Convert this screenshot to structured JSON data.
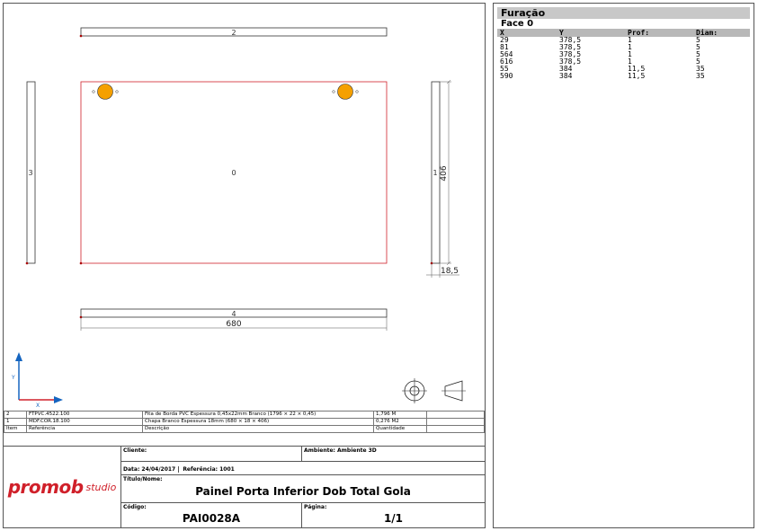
{
  "drawing": {
    "labels": {
      "top_strip": "2",
      "left_strip": "3",
      "panel_center": "0",
      "right_strip": "1",
      "right_dim": "406",
      "thickness_dim": "18,5",
      "bottom_strip": "4",
      "bottom_dim": "680",
      "axis_y": "Y",
      "axis_x": "X"
    },
    "colors": {
      "panel_edge": "#d0202a",
      "hole_fill": "#f5a000",
      "axis": "#1565c0"
    }
  },
  "parts_table": {
    "rows": [
      {
        "item": "2",
        "ref": "FTPVC.4522.100",
        "desc": "Fita de Borda PVC Espessura 0,45x22mm Branco (1796 × 22 × 0,45)",
        "qty": "1,796 M"
      },
      {
        "item": "1",
        "ref": "MDF.COR.18.100",
        "desc": "Chapa Branco Espessura 18mm (680 × 18 × 406)",
        "qty": "0,276 M2"
      }
    ],
    "header": {
      "item": "Item",
      "ref": "Referência",
      "desc": "Descrição",
      "qty": "Quantidade"
    }
  },
  "title_block": {
    "brand": "promob",
    "brand_suffix": "studio",
    "client_label": "Cliente:",
    "ambient_label": "Ambiente: Ambiente 3D",
    "date_label": "Data: 24/04/2017",
    "ref_label": "Referência: 1001",
    "title_label": "Título/Nome:",
    "title_value": "Painel Porta Inferior Dob Total Gola",
    "code_label": "Código:",
    "code_value": "PAI0028A",
    "page_label": "Página:",
    "page_value": "1/1"
  },
  "holes": {
    "title": "Furação",
    "face": "Face 0",
    "columns": [
      "X",
      "Y",
      "Prof:",
      "Diam:"
    ],
    "rows": [
      [
        "29",
        "378,5",
        "1",
        "5"
      ],
      [
        "81",
        "378,5",
        "1",
        "5"
      ],
      [
        "564",
        "378,5",
        "1",
        "5"
      ],
      [
        "616",
        "378,5",
        "1",
        "5"
      ],
      [
        "55",
        "384",
        "11,5",
        "35"
      ],
      [
        "590",
        "384",
        "11,5",
        "35"
      ]
    ]
  }
}
